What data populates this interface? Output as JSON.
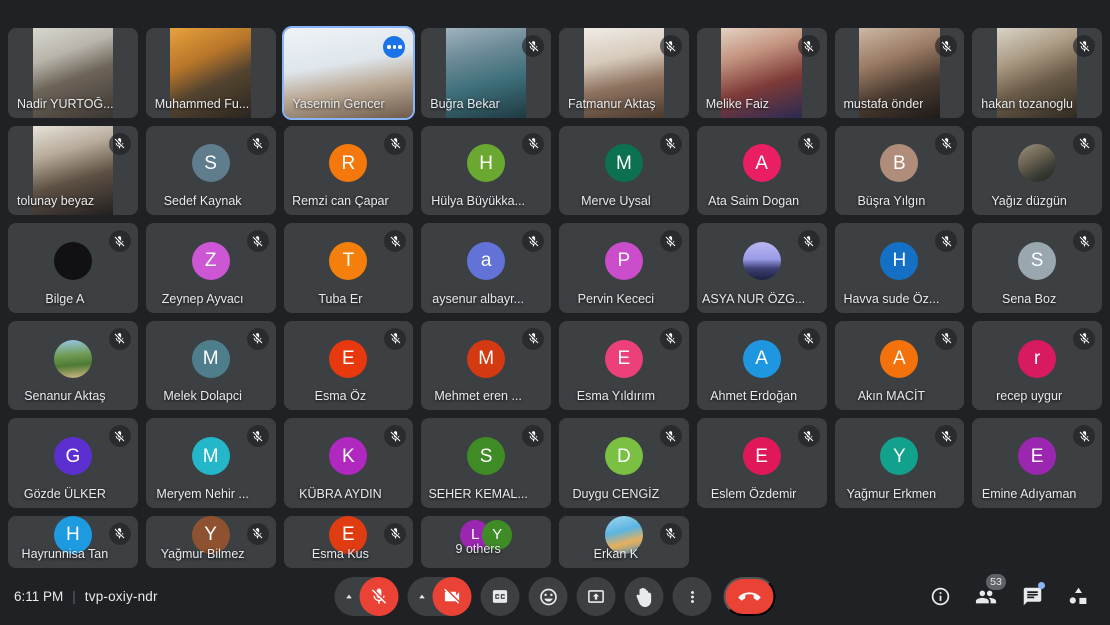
{
  "meeting": {
    "time": "6:11 PM",
    "code": "tvp-oxiy-ndr",
    "participant_count": "53",
    "others_label": "9 others"
  },
  "colors": {
    "tile_bg": "#3c4043",
    "page_bg": "#202124",
    "speaking_outline": "#8ab4f8",
    "danger": "#ea4335",
    "accent_blue": "#1a73e8"
  },
  "participants": [
    {
      "name": "Nadir YURTOĞ...",
      "type": "video",
      "muted": false,
      "speaking": false,
      "menu": false,
      "photo": "linear-gradient(160deg,#d8d6cf 0%,#b9b5ab 30%,#6d6459 55%,#3a3630 100%)"
    },
    {
      "name": "Muhammed Fu...",
      "type": "video",
      "muted": false,
      "speaking": false,
      "menu": false,
      "photo": "linear-gradient(155deg,#e8a23c 0%,#b8752a 35%,#54442f 60%,#2b2620 100%)"
    },
    {
      "name": "Yasemin Gencer",
      "type": "video",
      "muted": false,
      "speaking": true,
      "menu": true,
      "photo": "linear-gradient(170deg,#eef3f7 0%,#dfe6ec 40%,#b9a894 65%,#6d5a4b 100%)"
    },
    {
      "name": "Buğra Bekar",
      "type": "video",
      "muted": true,
      "speaking": false,
      "menu": false,
      "photo": "linear-gradient(165deg,#9fb3bd 0%,#6d8a98 30%,#3e6f7a 60%,#1f3a42 100%)"
    },
    {
      "name": "Fatmanur Aktaş",
      "type": "video",
      "muted": true,
      "speaking": false,
      "menu": false,
      "photo": "linear-gradient(168deg,#f0ece6 0%,#d6cabb 35%,#8e7260 62%,#4a3a2e 100%)"
    },
    {
      "name": "Melike Faiz",
      "type": "video",
      "muted": true,
      "speaking": false,
      "menu": false,
      "photo": "linear-gradient(162deg,#e4d2c2 0%,#c3937f 30%,#7d3a38 62%,#2a2b52 100%)"
    },
    {
      "name": "mustafa önder",
      "type": "video",
      "muted": true,
      "speaking": false,
      "menu": false,
      "photo": "linear-gradient(160deg,#cbb8a6 0%,#9a7a62 35%,#4a3b31 65%,#1e1b18 100%)"
    },
    {
      "name": "hakan tozanoglu",
      "type": "video",
      "muted": true,
      "speaking": false,
      "menu": false,
      "photo": "linear-gradient(158deg,#d9d4c8 0%,#ab9b84 32%,#6a5b48 60%,#2f2a22 100%)"
    },
    {
      "name": "tolunay beyaz",
      "type": "video",
      "muted": true,
      "speaking": false,
      "menu": false,
      "photo": "linear-gradient(164deg,#e6e2db 0%,#b8ab9b 30%,#5d5043 60%,#232020 100%)"
    },
    {
      "name": "Sedef Kaynak",
      "type": "avatar",
      "initial": "S",
      "color": "#5f7d8c",
      "muted": true
    },
    {
      "name": "Remzi can Çapar",
      "type": "avatar",
      "initial": "R",
      "color": "#f4780b",
      "muted": true
    },
    {
      "name": "Hülya Büyükka...",
      "type": "avatar",
      "initial": "H",
      "color": "#6aa832",
      "muted": true
    },
    {
      "name": "Merve Uysal",
      "type": "avatar",
      "initial": "M",
      "color": "#0b7150",
      "muted": true
    },
    {
      "name": "Ata Saim Dogan",
      "type": "avatar",
      "initial": "A",
      "color": "#e91e63",
      "muted": true
    },
    {
      "name": "Büşra Yılgın",
      "type": "avatar",
      "initial": "B",
      "color": "#b08d7a",
      "muted": true
    },
    {
      "name": "Yağız düzgün",
      "type": "photo-avatar",
      "color": "#6b6455",
      "muted": true,
      "photo": "linear-gradient(150deg,#9a917f 0%,#6a6252 40%,#3a3c36 70%,#24241f 100%)"
    },
    {
      "name": "Bilge A",
      "type": "avatar",
      "initial": "",
      "color": "#111114",
      "muted": true
    },
    {
      "name": "Zeynep Ayvacı",
      "type": "avatar",
      "initial": "Z",
      "color": "#cd56d4",
      "muted": true
    },
    {
      "name": "Tuba Er",
      "type": "avatar",
      "initial": "T",
      "color": "#f4800b",
      "muted": true
    },
    {
      "name": "aysenur albayr...",
      "type": "avatar",
      "initial": "a",
      "color": "#6272d6",
      "muted": true
    },
    {
      "name": "Pervin Kececi",
      "type": "avatar",
      "initial": "P",
      "color": "#cc4dcc",
      "muted": true
    },
    {
      "name": "ASYA NUR ÖZG...",
      "type": "photo-avatar",
      "color": "#8c94e0",
      "muted": true,
      "photo": "linear-gradient(180deg,#b9b6ef 0%,#9a9be8 45%,#3d3f72 70%,#1b2240 100%)"
    },
    {
      "name": "Havva sude Öz...",
      "type": "avatar",
      "initial": "H",
      "color": "#1470c4",
      "muted": true
    },
    {
      "name": "Sena Boz",
      "type": "avatar",
      "initial": "S",
      "color": "#9aa7ae",
      "muted": true
    },
    {
      "name": "Senanur Aktaş",
      "type": "photo-avatar",
      "color": "#6d8a4a",
      "muted": true,
      "photo": "linear-gradient(175deg,#96c8e8 0%,#6f9c54 40%,#4e7a33 65%,#d8b98a 100%)"
    },
    {
      "name": "Melek Dolapci",
      "type": "avatar",
      "initial": "M",
      "color": "#4e7e8c",
      "muted": true
    },
    {
      "name": "Esma Öz",
      "type": "avatar",
      "initial": "E",
      "color": "#e8380d",
      "muted": true
    },
    {
      "name": "Mehmet eren ...",
      "type": "avatar",
      "initial": "M",
      "color": "#d43a12",
      "muted": true
    },
    {
      "name": "Esma Yıldırım",
      "type": "avatar",
      "initial": "E",
      "color": "#ec407a",
      "muted": true
    },
    {
      "name": "Ahmet Erdoğan",
      "type": "avatar",
      "initial": "A",
      "color": "#1e96e0",
      "muted": true
    },
    {
      "name": "Akın MACİT",
      "type": "avatar",
      "initial": "A",
      "color": "#f4720b",
      "muted": true
    },
    {
      "name": "recep uygur",
      "type": "avatar",
      "initial": "r",
      "color": "#d81b60",
      "muted": true
    },
    {
      "name": "Gözde ÜLKER",
      "type": "avatar",
      "initial": "G",
      "color": "#5b2fd0",
      "muted": true
    },
    {
      "name": "Meryem Nehir ...",
      "type": "avatar",
      "initial": "M",
      "color": "#24b6c9",
      "muted": true
    },
    {
      "name": "KÜBRA AYDIN",
      "type": "avatar",
      "initial": "K",
      "color": "#b028c0",
      "muted": true
    },
    {
      "name": "SEHER KEMAL...",
      "type": "avatar",
      "initial": "S",
      "color": "#3f8c26",
      "muted": true
    },
    {
      "name": "Duygu CENGİZ",
      "type": "avatar",
      "initial": "D",
      "color": "#7ac143",
      "muted": true
    },
    {
      "name": "Eslem Özdemir",
      "type": "avatar",
      "initial": "E",
      "color": "#e0185a",
      "muted": true
    },
    {
      "name": "Yağmur Erkmen",
      "type": "avatar",
      "initial": "Y",
      "color": "#12a18c",
      "muted": true
    },
    {
      "name": "Emine Adıyaman",
      "type": "avatar",
      "initial": "E",
      "color": "#9b27b0",
      "muted": true
    },
    {
      "name": "Hayrunnisa Tan",
      "type": "avatar",
      "initial": "H",
      "color": "#1e9ae0",
      "muted": true
    },
    {
      "name": "Yağmur Bilmez",
      "type": "avatar",
      "initial": "Y",
      "color": "#8e5230",
      "muted": true
    },
    {
      "name": "Esma Kus",
      "type": "avatar",
      "initial": "E",
      "color": "#e03c12",
      "muted": true
    },
    {
      "name": "9 others",
      "type": "others",
      "muted": false,
      "group": [
        {
          "initial": "L",
          "color": "#9b27b0"
        },
        {
          "initial": "Y",
          "color": "#3f8c26"
        }
      ]
    },
    {
      "name": "Erkan K",
      "type": "photo-avatar",
      "color": "#4aa3d8",
      "muted": true,
      "photo": "linear-gradient(165deg,#9fd8f0 0%,#5cb4e0 40%,#e8b05a 68%,#4a90c0 100%)"
    }
  ],
  "controls": {
    "mic": {
      "label": "Turn off microphone",
      "icon": "mic-off-icon",
      "active": true
    },
    "mic_caret": {
      "label": "Audio settings",
      "icon": "chevron-up-icon"
    },
    "camera": {
      "label": "Turn on camera",
      "icon": "video-off-icon",
      "active": true
    },
    "camera_caret": {
      "label": "Video settings",
      "icon": "chevron-up-icon"
    },
    "captions": {
      "label": "Turn on captions",
      "icon": "closed-caption-icon"
    },
    "reactions": {
      "label": "Send a reaction",
      "icon": "emoji-icon"
    },
    "present": {
      "label": "Present now",
      "icon": "present-screen-icon"
    },
    "raise_hand": {
      "label": "Raise hand",
      "icon": "raise-hand-icon"
    },
    "more": {
      "label": "More options",
      "icon": "more-vertical-icon"
    },
    "hangup": {
      "label": "Leave call",
      "icon": "end-call-icon"
    }
  },
  "right_controls": {
    "info": {
      "label": "Meeting details",
      "icon": "info-icon"
    },
    "people": {
      "label": "Show everyone",
      "icon": "people-icon",
      "badge": "53"
    },
    "chat": {
      "label": "Chat with everyone",
      "icon": "chat-icon",
      "has_notification": true
    },
    "activities": {
      "label": "Activities",
      "icon": "activities-icon"
    }
  }
}
